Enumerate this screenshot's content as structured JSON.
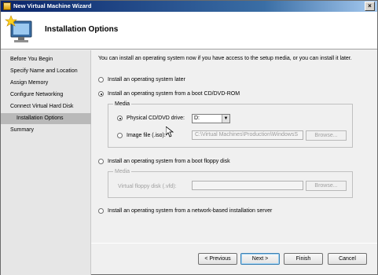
{
  "window": {
    "title": "New Virtual Machine Wizard",
    "close_glyph": "×"
  },
  "header": {
    "title": "Installation Options"
  },
  "nav": {
    "items": [
      {
        "label": "Before You Begin"
      },
      {
        "label": "Specify Name and Location"
      },
      {
        "label": "Assign Memory"
      },
      {
        "label": "Configure Networking"
      },
      {
        "label": "Connect Virtual Hard Disk"
      },
      {
        "label": "Installation Options",
        "active": true
      },
      {
        "label": "Summary"
      }
    ]
  },
  "main": {
    "intro": "You can install an operating system now if you have access to the setup media, or you can install it later.",
    "options": {
      "later": "Install an operating system later",
      "cd": "Install an operating system from a boot CD/DVD-ROM",
      "floppy": "Install an operating system from a boot floppy disk",
      "network": "Install an operating system from a network-based installation server"
    },
    "cd_media": {
      "legend": "Media",
      "physical_label": "Physical CD/DVD drive:",
      "drive_value": "D:",
      "image_label": "Image file (.iso):",
      "image_path": "C:\\Virtual Machines\\Production\\WindowsS",
      "browse": "Browse..."
    },
    "floppy_media": {
      "legend": "Media",
      "vfd_label": "Virtual floppy disk (.vfd):",
      "vfd_path": "",
      "browse": "Browse..."
    }
  },
  "footer": {
    "previous": "< Previous",
    "next": "Next >",
    "finish": "Finish",
    "cancel": "Cancel"
  },
  "colors": {
    "title_start": "#0a246a",
    "title_end": "#a6caf0",
    "nav_bg": "#e6e6e6",
    "nav_active": "#b9b9b9"
  }
}
